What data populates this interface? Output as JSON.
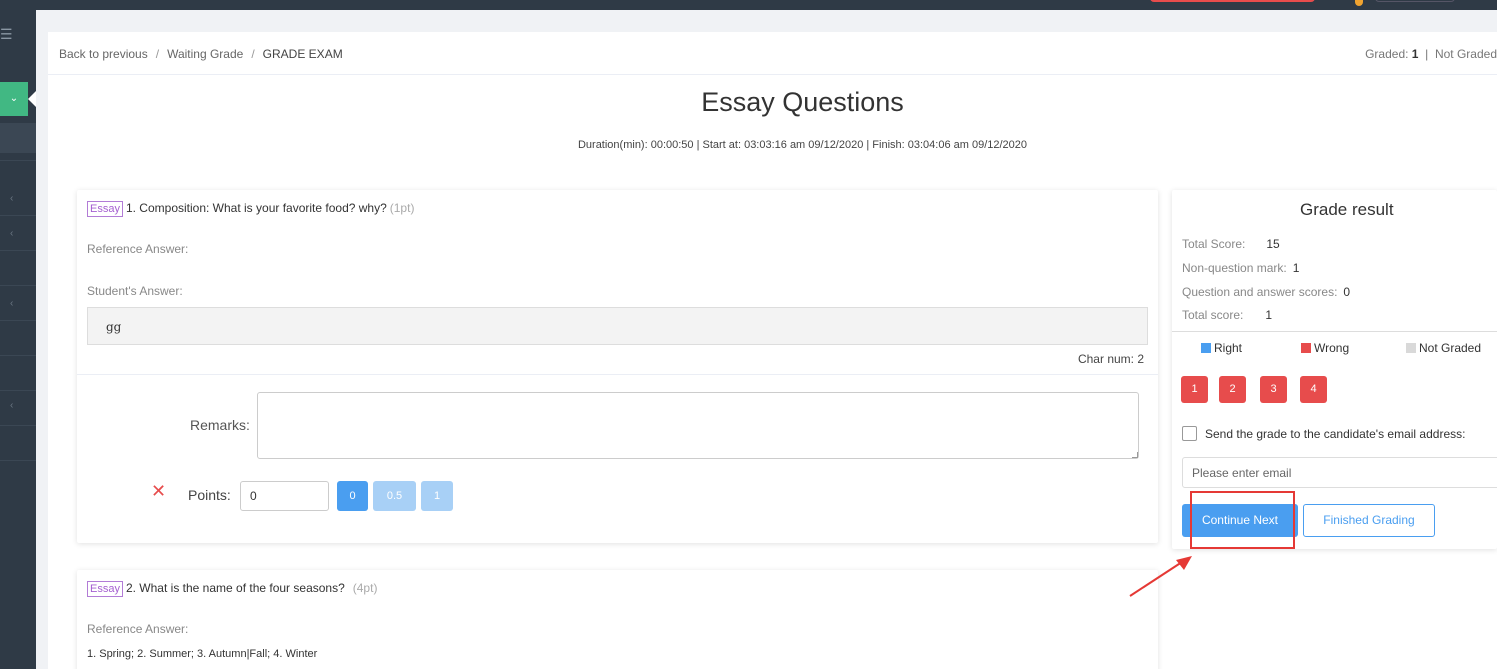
{
  "breadcrumb": {
    "back": "Back to previous",
    "waiting": "Waiting Grade",
    "current": "GRADE EXAM",
    "separator": "/"
  },
  "graded_summary": {
    "graded_label": "Graded",
    "graded_value": "1",
    "divider": "|",
    "not_graded_label": "Not Graded"
  },
  "page_title": "Essay Questions",
  "meta_line": "Duration(min): 00:00:50 | Start at: 03:03:16 am 09/12/2020 | Finish: 03:04:06 am 09/12/2020",
  "questions": [
    {
      "tag": "Essay",
      "title": "1. Composition: What is your favorite food? why?",
      "points": "(1pt)",
      "reference_label": "Reference Answer:",
      "reference_answer": "",
      "student_label": "Student's Answer:",
      "student_answer": "gg",
      "char_num": "Char num: 2",
      "remarks_label": "Remarks:",
      "points_label": "Points:",
      "points_value": "0",
      "point_buttons": [
        "0",
        "0.5",
        "1"
      ]
    },
    {
      "tag": "Essay",
      "title": "2. What is the name of the four seasons?",
      "points": "(4pt)",
      "reference_label": "Reference Answer:",
      "reference_answer": "1. Spring; 2. Summer; 3. Autumn|Fall; 4. Winter"
    }
  ],
  "grade_panel": {
    "title": "Grade result",
    "rows": [
      {
        "label": "Total Score:",
        "value": "15"
      },
      {
        "label": "Non-question mark:",
        "value": "1"
      },
      {
        "label": "Question and answer scores:",
        "value": "0"
      },
      {
        "label": "Total score:",
        "value": "1"
      }
    ],
    "legend": [
      {
        "label": "Right",
        "color": "#4a9ef0"
      },
      {
        "label": "Wrong",
        "color": "#e74c4c"
      },
      {
        "label": "Not Graded",
        "color": "#d9d9d9"
      }
    ],
    "question_numbers": [
      "1",
      "2",
      "3",
      "4"
    ],
    "email_label": "Send the grade to the candidate's email address:",
    "email_placeholder": "Please enter email",
    "continue_label": "Continue Next",
    "finish_label": "Finished Grading"
  },
  "colors": {
    "accent": "#4a9ef0",
    "wrong": "#e74c4c",
    "sidebar": "#2f3a46",
    "sidebar_active": "#41b883",
    "highlight": "#e53935"
  }
}
